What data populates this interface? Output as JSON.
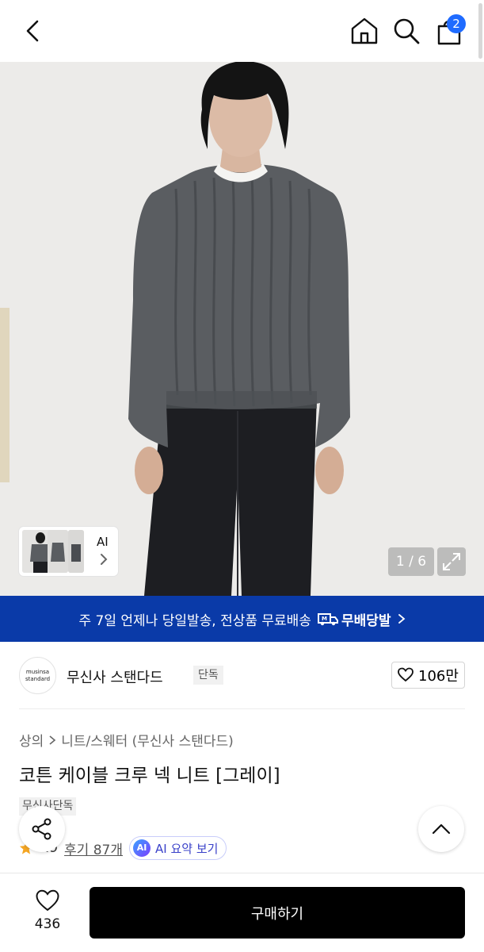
{
  "header": {
    "cart_count": "2",
    "icons": [
      "back-icon",
      "home-icon",
      "search-icon",
      "cart-icon"
    ]
  },
  "gallery": {
    "thumbnail_label": "AI",
    "counter": "1 / 6",
    "current_index": 1,
    "total_images": 6
  },
  "banner": {
    "text": "주 7일 언제나 당일발송, 전상품 무료배송",
    "brand": "무배당발"
  },
  "brand": {
    "logo_line1": "musinsa",
    "logo_line2": "standard",
    "name": "무신사 스탠다드",
    "tag": "단독",
    "likes": "106만"
  },
  "product": {
    "breadcrumb": [
      "상의",
      "니트/스웨터 (무신사 스탠다드)"
    ],
    "title": "코튼 케이블 크루 넥 니트 [그레이]",
    "badge": "무신사단독",
    "rating": "4.9",
    "reviews": "후기 87개",
    "ai_badge": "AI",
    "ai_summary": "AI 요약 보기"
  },
  "bottom": {
    "wish_count": "436",
    "buy_label": "구매하기"
  },
  "colors": {
    "accent_blue": "#1f6bff",
    "banner_bg": "#0a3aa8",
    "buy_bg": "#000000"
  }
}
